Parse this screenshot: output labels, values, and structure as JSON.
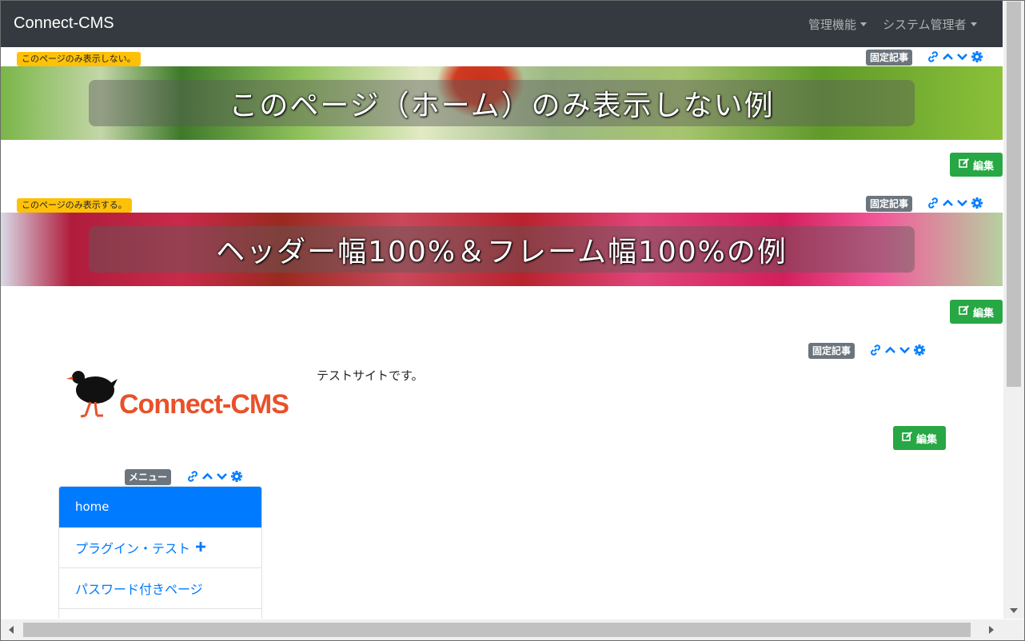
{
  "navbar": {
    "brand": "Connect-CMS",
    "menu_admin": "管理機能",
    "menu_user": "システム管理者"
  },
  "frames": {
    "frame1": {
      "visibility_note": "このページのみ表示しない。",
      "badge": "固定記事",
      "banner_text": "このページ（ホーム）のみ表示しない例",
      "edit_label": "編集"
    },
    "frame2": {
      "visibility_note": "このページのみ表示する。",
      "badge": "固定記事",
      "banner_text": "ヘッダー幅100%＆フレーム幅100%の例",
      "edit_label": "編集"
    },
    "frame3": {
      "badge": "固定記事",
      "logo_text": "Connect-CMS",
      "body_text": "テストサイトです。",
      "edit_label": "編集"
    },
    "menu_frame": {
      "badge": "メニュー",
      "items": [
        {
          "label": "home",
          "active": true
        },
        {
          "label": "プラグイン・テスト",
          "expand": "+"
        },
        {
          "label": "パスワード付きページ"
        },
        {
          "label": ""
        }
      ]
    }
  },
  "colors": {
    "navbar_bg": "#343a40",
    "primary": "#007bff",
    "success": "#28a745",
    "warning": "#ffc107",
    "secondary": "#6c757d"
  },
  "icons": [
    "link-icon",
    "chevron-up-icon",
    "chevron-down-icon",
    "gear-icon",
    "edit-icon",
    "plus-icon"
  ]
}
